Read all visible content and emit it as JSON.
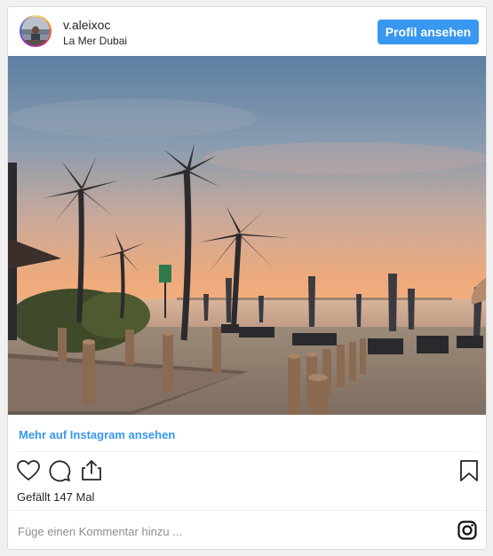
{
  "header": {
    "username": "v.aleixoc",
    "location": "La Mer Dubai",
    "profile_button_label": "Profil ansehen"
  },
  "post": {
    "more_link_label": "Mehr auf Instagram ansehen",
    "likes_text": "Gefällt 147 Mal"
  },
  "comment": {
    "placeholder": "Füge einen Kommentar hinzu ..."
  },
  "icons": {
    "like": "heart-icon",
    "comment": "comment-bubble-icon",
    "share": "share-icon",
    "save": "bookmark-icon",
    "brand": "instagram-icon"
  },
  "colors": {
    "accent": "#3897f0",
    "text": "#262626",
    "muted": "#8e8e8e",
    "border": "#dbdbdb"
  }
}
